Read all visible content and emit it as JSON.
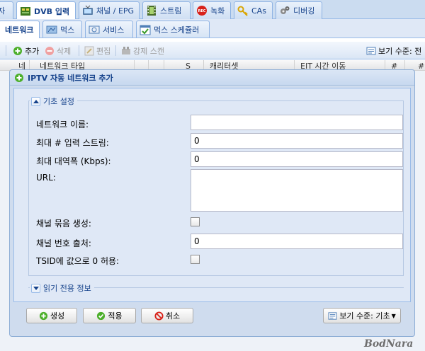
{
  "main_tabs": [
    {
      "label": "자"
    },
    {
      "label": "DVB 입력"
    },
    {
      "label": "채널 / EPG"
    },
    {
      "label": "스트림"
    },
    {
      "label": "녹화"
    },
    {
      "label": "CAs"
    },
    {
      "label": "디버깅"
    }
  ],
  "sub_tabs": [
    {
      "label": "네트워크"
    },
    {
      "label": "먹스"
    },
    {
      "label": "서비스"
    },
    {
      "label": "먹스 스케쥴러"
    }
  ],
  "toolbar": {
    "add": "추가",
    "delete": "삭제",
    "edit": "편집",
    "force_scan": "강제 스캔",
    "view_level": "보기 수준: 전"
  },
  "grid_headers": [
    "네",
    "네트워크 타입",
    "S",
    "캐리터셋",
    "EIT 시간 이동",
    "#",
    "#"
  ],
  "dialog": {
    "title": "IPTV 자동 네트워크 추가",
    "basic_section": "기초 설정",
    "fields": {
      "network_name": {
        "label": "네트워크 이름:",
        "value": ""
      },
      "max_input_streams": {
        "label": "최대 # 입력 스트림:",
        "value": "0"
      },
      "max_bandwidth": {
        "label": "최대 대역폭 (Kbps):",
        "value": "0"
      },
      "url": {
        "label": "URL:",
        "value": ""
      },
      "create_bouquet": {
        "label": "채널 묶음 생성:",
        "checked": false
      },
      "channel_number_source": {
        "label": "채널 번호 출처:",
        "value": "0"
      },
      "accept_zero_tsid": {
        "label": "TSID에 값으로 0 허용:",
        "checked": false
      }
    },
    "readonly_section": "읽기 전용 정보",
    "buttons": {
      "create": "생성",
      "apply": "적용",
      "cancel": "취소",
      "view_level": "보기 수준: 기초"
    }
  },
  "watermark": "BodNara",
  "colors": {
    "accent": "#15428b",
    "panel": "#dfe8f6",
    "border": "#99bbe8"
  }
}
